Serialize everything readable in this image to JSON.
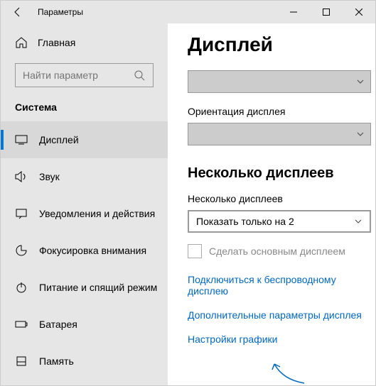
{
  "window": {
    "title": "Параметры"
  },
  "sidebar": {
    "home": "Главная",
    "search_placeholder": "Найти параметр",
    "category": "Система",
    "items": [
      {
        "label": "Дисплей"
      },
      {
        "label": "Звук"
      },
      {
        "label": "Уведомления и действия"
      },
      {
        "label": "Фокусировка внимания"
      },
      {
        "label": "Питание и спящий режим"
      },
      {
        "label": "Батарея"
      },
      {
        "label": "Память"
      }
    ]
  },
  "content": {
    "heading": "Дисплей",
    "orientation_label": "Ориентация дисплея",
    "multi_heading": "Несколько дисплеев",
    "multi_label": "Несколько дисплеев",
    "multi_selected": "Показать только на 2",
    "primary_checkbox": "Сделать основным дисплеем",
    "link_wireless": "Подключиться к беспроводному дисплею",
    "link_advanced": "Дополнительные параметры дисплея",
    "link_graphics": "Настройки графики"
  }
}
